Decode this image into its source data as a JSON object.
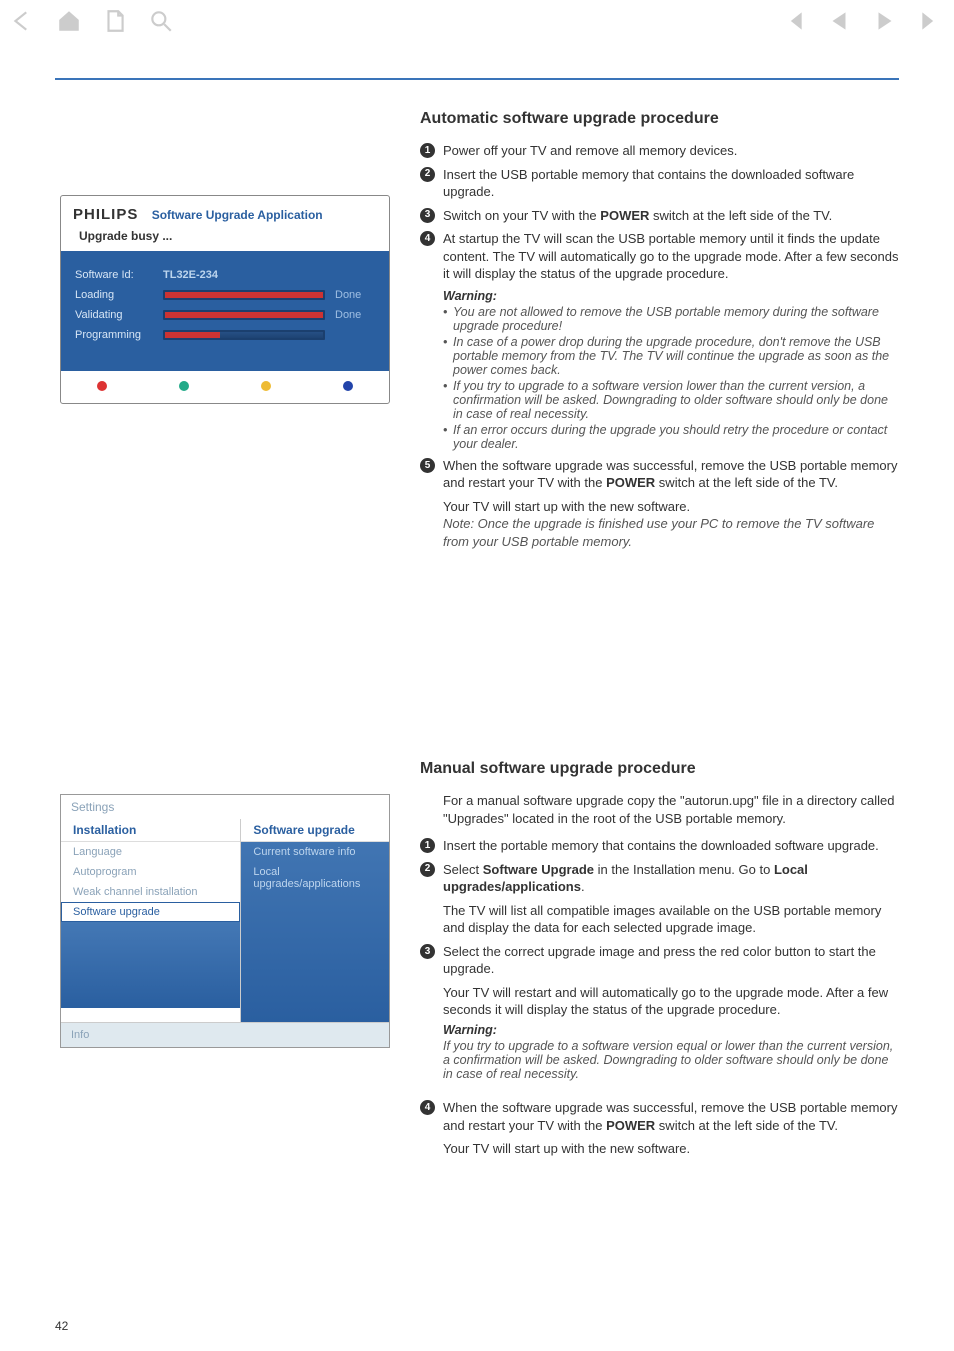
{
  "toolbar": {
    "icons_left": [
      "back-arrow",
      "home",
      "page",
      "search"
    ],
    "icons_right": [
      "first",
      "prev",
      "next",
      "last"
    ]
  },
  "page_number": "42",
  "section1": {
    "title": "Automatic software upgrade procedure",
    "steps": [
      "Power off your TV and remove all memory devices.",
      "Insert the USB portable memory that contains the downloaded software upgrade.",
      "Switch on your TV with the POWER switch at the left side of the TV.",
      "At startup the TV will scan the USB portable memory until it finds the update content. The TV will automatically go to the upgrade mode. After a few seconds it will display the status of the upgrade procedure."
    ],
    "warning_title": "Warning:",
    "warnings": [
      "You are not allowed to remove the USB portable memory during the software upgrade procedure!",
      "In case of a power drop during the upgrade procedure, don't remove the USB portable memory from the TV. The TV will continue the upgrade as soon as the power comes back.",
      "If you try to upgrade to a software version lower than the current version, a confirmation will be asked. Downgrading to older software should only be done in case of real necessity.",
      "If an error occurs during the upgrade you should retry the procedure or contact your dealer."
    ],
    "step5": "When the software upgrade was successful, remove the USB portable memory and restart your TV with the POWER switch at the left side of the TV.",
    "step5_cont": "Your TV will start up with the new software.",
    "note": "Note: Once the upgrade is finished use your PC to remove the TV software from your USB portable memory."
  },
  "section2": {
    "title": "Manual software upgrade procedure",
    "intro": "For a manual software upgrade copy the \"autorun.upg\" file in a directory called \"Upgrades\" located in the root of the USB portable memory.",
    "steps": [
      "Insert the portable memory that contains the downloaded software upgrade.",
      "Select Software Upgrade in the Installation menu. Go to Local upgrades/applications.",
      "Select the correct upgrade image and press the red color button to start the upgrade."
    ],
    "step2_cont": "The TV will list all compatible images available on the USB portable memory and display the data for each selected upgrade image.",
    "step3_cont1": "Your TV will restart and will automatically go to the upgrade mode. After a few seconds it will display the status of the upgrade procedure.",
    "warning_title": "Warning:",
    "warning_text": "If you try to upgrade to a software version equal or lower than the current version, a confirmation will be asked. Downgrading to older software should only be done in case of real necessity.",
    "step4": "When the software upgrade was successful, remove the USB portable memory and restart your TV with the POWER switch at the left side of the TV.",
    "step4_cont": "Your TV will start up with the new software."
  },
  "fig1": {
    "brand": "PHILIPS",
    "app_title": "Software Upgrade Application",
    "status": "Upgrade busy ...",
    "rows": [
      {
        "label": "Software Id:",
        "value": "TL32E-234",
        "bar": false,
        "status": ""
      },
      {
        "label": "Loading",
        "value": "",
        "bar": true,
        "fill": 100,
        "status": "Done"
      },
      {
        "label": "Validating",
        "value": "",
        "bar": true,
        "fill": 100,
        "status": "Done"
      },
      {
        "label": "Programming",
        "value": "",
        "bar": true,
        "fill": 35,
        "status": ""
      }
    ]
  },
  "fig2": {
    "breadcrumb": "Settings",
    "left_title": "Installation",
    "right_title": "Software upgrade",
    "left_items": [
      "Language",
      "Autoprogram",
      "Weak channel installation",
      "Software upgrade"
    ],
    "left_selected_index": 3,
    "right_items": [
      "Current software info",
      "Local upgrades/applications"
    ],
    "info_label": "Info"
  }
}
